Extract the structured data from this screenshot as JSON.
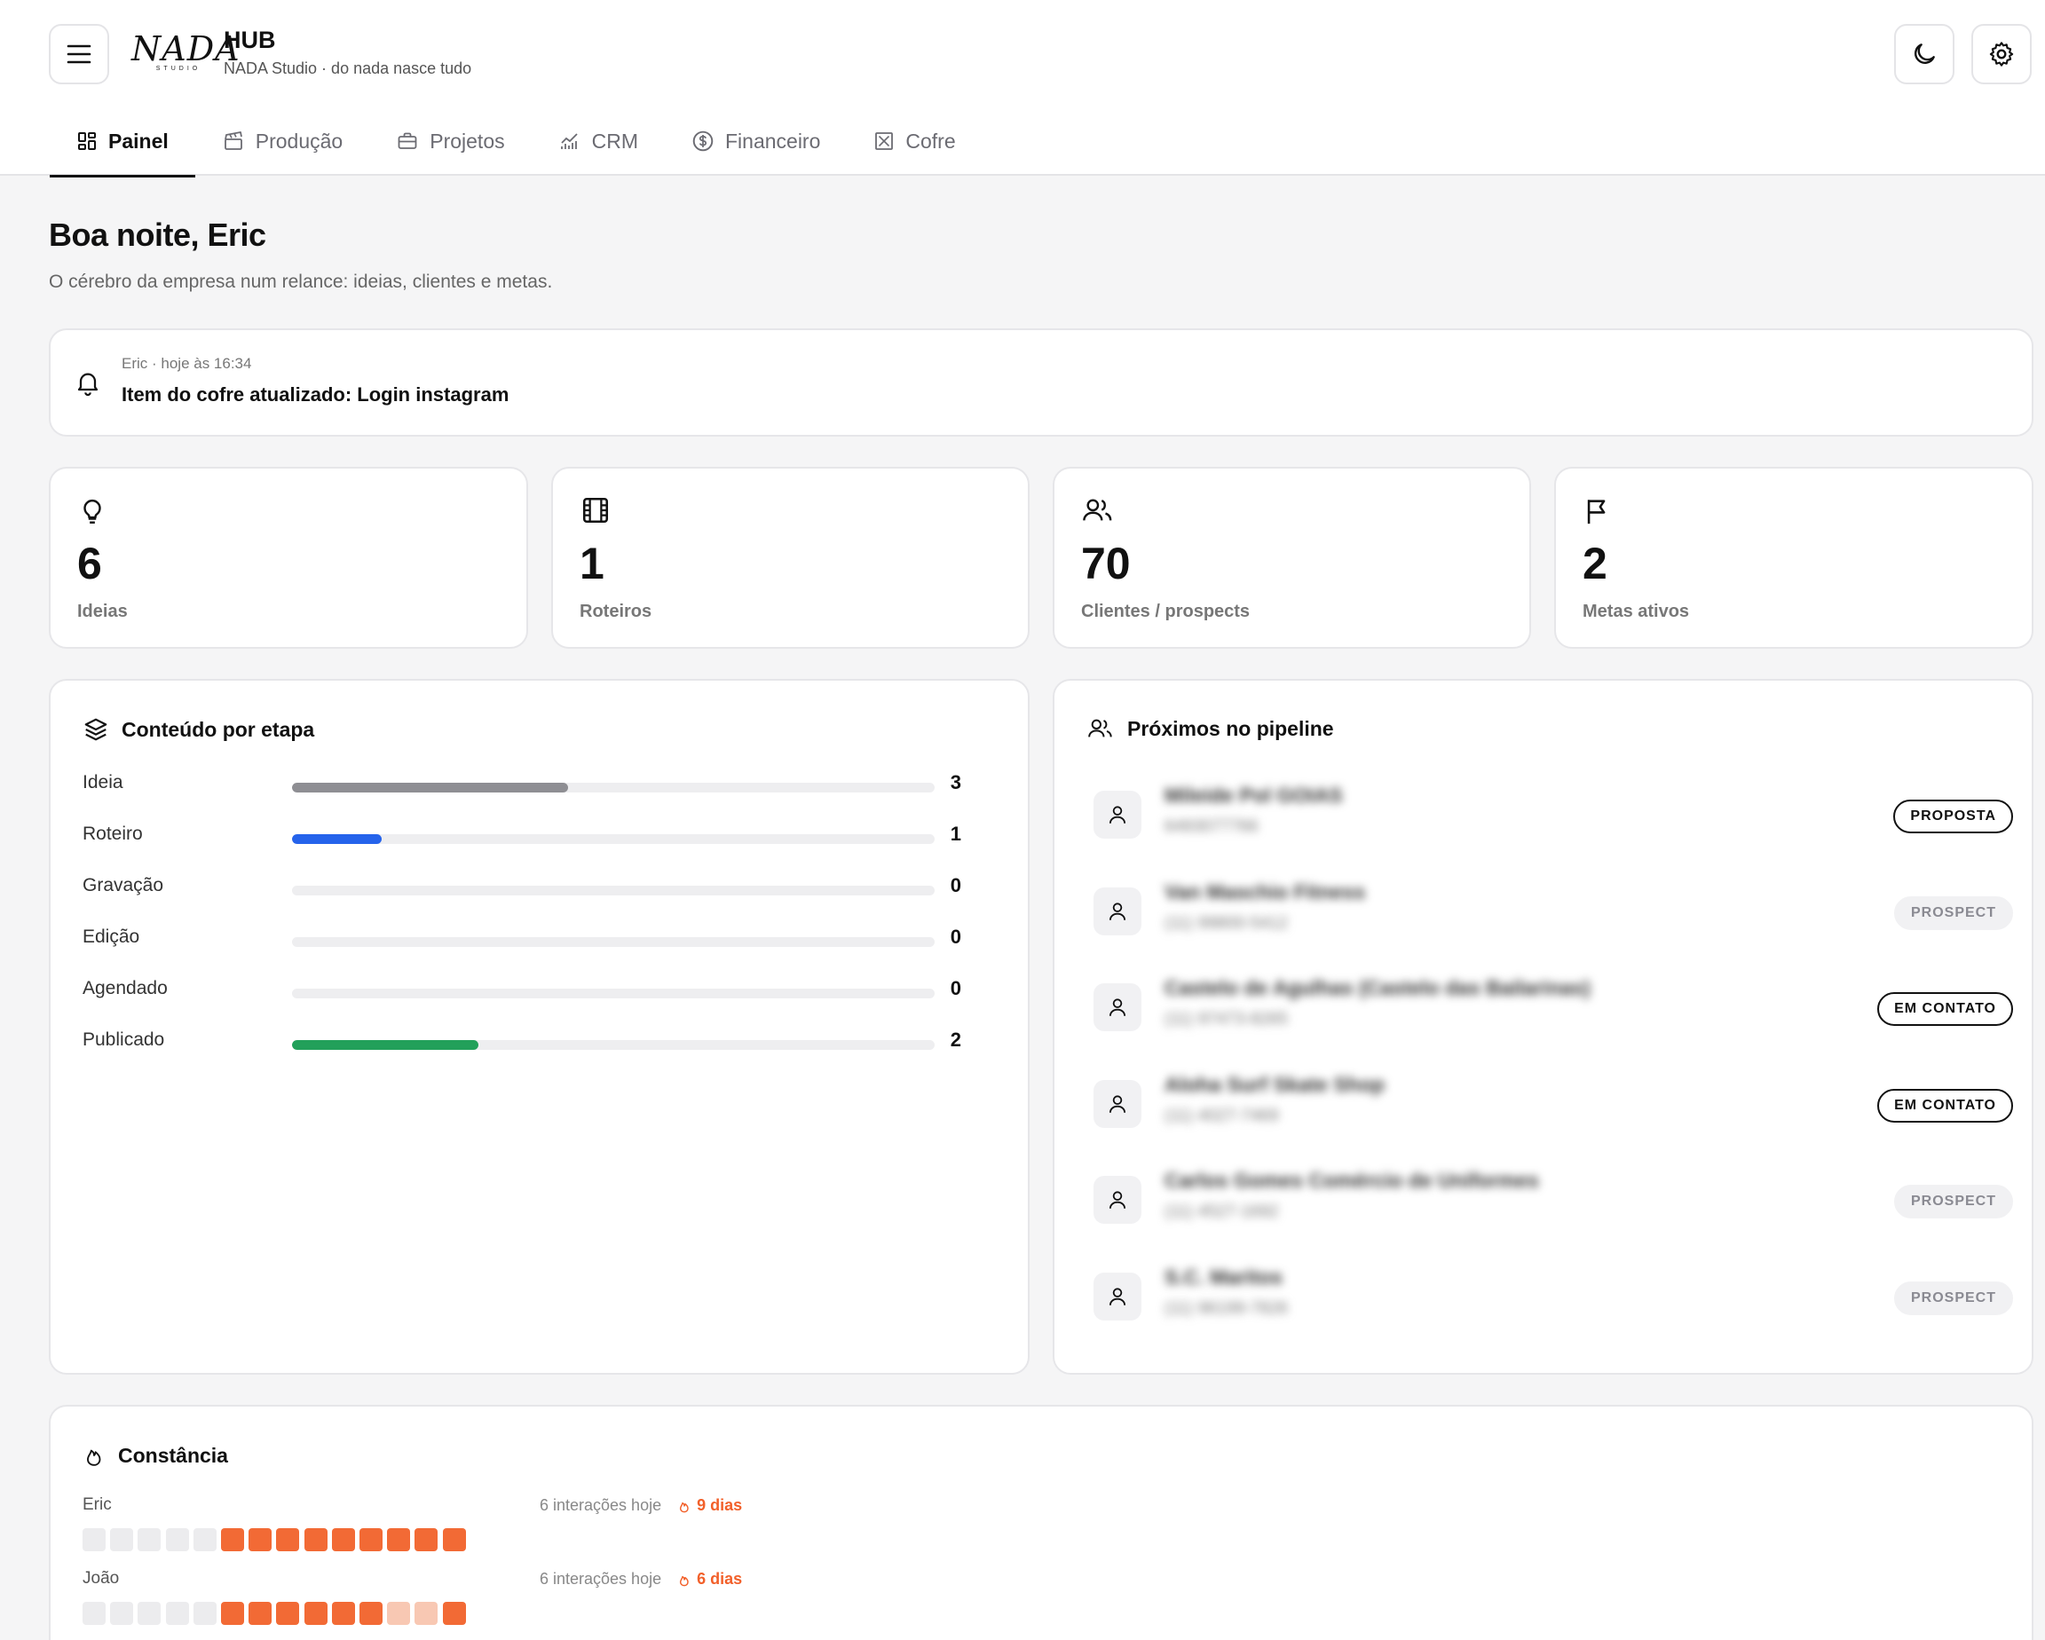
{
  "header": {
    "logo_word": "NADA",
    "logo_sub": "STUDIO",
    "app_title": "HUB",
    "app_subtitle": "NADA Studio · do nada nasce tudo",
    "menu_icon": "menu-icon",
    "theme_icon": "moon-icon",
    "settings_icon": "gear-icon"
  },
  "tabs": [
    {
      "label": "Painel",
      "icon": "dashboard-icon",
      "active": true
    },
    {
      "label": "Produção",
      "icon": "clapperboard-icon",
      "active": false
    },
    {
      "label": "Projetos",
      "icon": "briefcase-icon",
      "active": false
    },
    {
      "label": "CRM",
      "icon": "chart-icon",
      "active": false
    },
    {
      "label": "Financeiro",
      "icon": "dollar-circle-icon",
      "active": false
    },
    {
      "label": "Cofre",
      "icon": "vault-icon",
      "active": false
    }
  ],
  "greeting": {
    "title": "Boa noite, Eric",
    "subtitle": "O cérebro da empresa num relance: ideias, clientes e metas."
  },
  "notification": {
    "meta": "Eric · hoje às 16:34",
    "message": "Item do cofre atualizado: Login instagram",
    "icon": "bell-icon"
  },
  "stats": [
    {
      "value": "6",
      "label": "Ideias",
      "icon": "lightbulb-icon"
    },
    {
      "value": "1",
      "label": "Roteiros",
      "icon": "film-icon"
    },
    {
      "value": "70",
      "label": "Clientes / prospects",
      "icon": "users-icon"
    },
    {
      "value": "2",
      "label": "Metas ativos",
      "icon": "flag-icon"
    }
  ],
  "content_by_stage": {
    "title": "Conteúdo por etapa",
    "icon": "layers-icon",
    "rows": [
      {
        "name": "Ideia",
        "count": "3",
        "fraction": 0.43,
        "color": "#8e8e93"
      },
      {
        "name": "Roteiro",
        "count": "1",
        "fraction": 0.14,
        "color": "#2563eb"
      },
      {
        "name": "Gravação",
        "count": "0",
        "fraction": 0,
        "color": "#8e8e93"
      },
      {
        "name": "Edição",
        "count": "0",
        "fraction": 0,
        "color": "#8e8e93"
      },
      {
        "name": "Agendado",
        "count": "0",
        "fraction": 0,
        "color": "#8e8e93"
      },
      {
        "name": "Publicado",
        "count": "2",
        "fraction": 0.29,
        "color": "#22a05a"
      }
    ]
  },
  "pipeline": {
    "title": "Próximos no pipeline",
    "icon": "users-icon",
    "items": [
      {
        "name": "Mileide Pol GOIAS",
        "phone": "6493077766",
        "status": "PROPOSTA",
        "style": "dark"
      },
      {
        "name": "Van Maschio Fitness",
        "phone": "(11) 99800-5412",
        "status": "PROSPECT",
        "style": "light"
      },
      {
        "name": "Castelo de Agulhas (Castelo das Bailarinas)",
        "phone": "(11) 97473-8265",
        "status": "EM CONTATO",
        "style": "dark"
      },
      {
        "name": "Aloha Surf Skate Shop",
        "phone": "(11) 4027-7469",
        "status": "EM CONTATO",
        "style": "dark"
      },
      {
        "name": "Carlos Gomes Comércio de Uniformes",
        "phone": "(11) 4527-1692",
        "status": "PROSPECT",
        "style": "light"
      },
      {
        "name": "S.C. Maritos",
        "phone": "(11) 96199-7826",
        "status": "PROSPECT",
        "style": "light"
      }
    ]
  },
  "consistency": {
    "title": "Constância",
    "icon": "flame-icon",
    "people": [
      {
        "name": "Eric",
        "interactions": "6 interações hoje",
        "streak": "9 dias",
        "days": [
          0,
          0,
          0,
          0,
          0,
          2,
          2,
          2,
          2,
          2,
          2,
          2,
          2,
          2
        ]
      },
      {
        "name": "João",
        "interactions": "6 interações hoje",
        "streak": "6 dias",
        "days": [
          0,
          0,
          0,
          0,
          0,
          2,
          2,
          2,
          2,
          2,
          2,
          1,
          1,
          2
        ]
      }
    ],
    "colors": {
      "empty": "#ececee",
      "active": "#f26a35",
      "faint": "#f8c8b3"
    }
  }
}
